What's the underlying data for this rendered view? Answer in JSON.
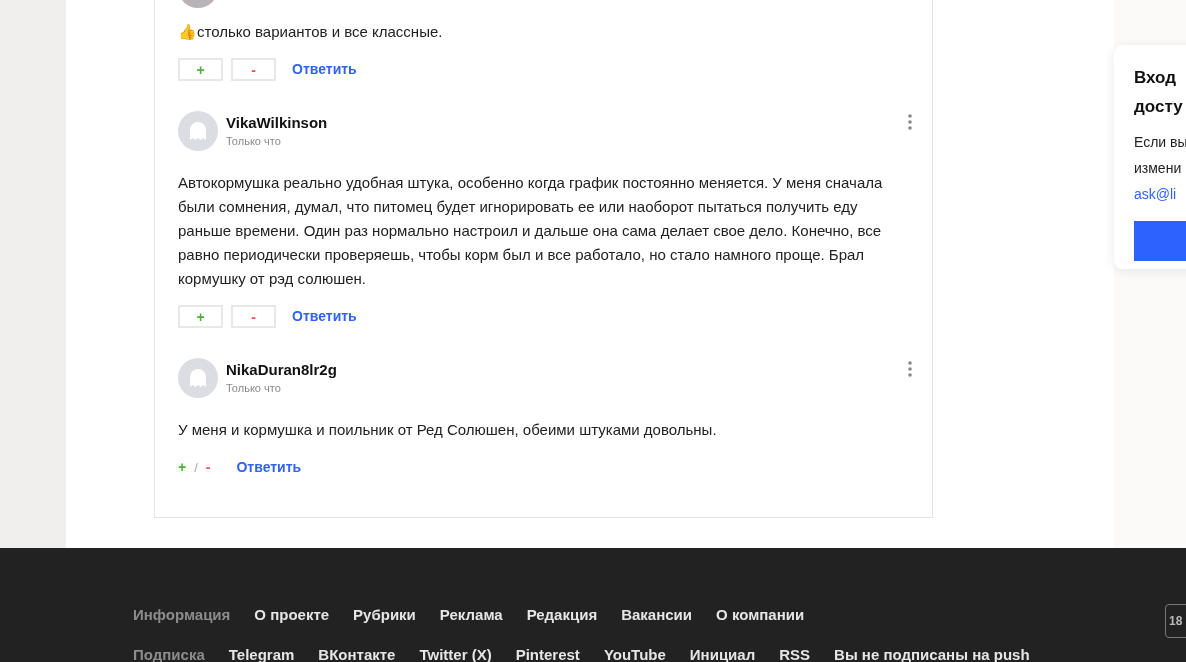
{
  "comments": [
    {
      "text": "👍столько вариантов и все классные.",
      "kind": "boxed",
      "vote_plus": "+",
      "vote_minus": "-",
      "reply": "Ответить"
    },
    {
      "author": "VikaWilkinson",
      "time": "Только что",
      "text": "Автокормушка реально удобная штука, особенно когда график постоянно меняется. У меня сначала были сомнения, думал, что питомец будет игнорировать ее или наоборот пытаться получить еду раньше времени. Один раз нормально настроил и дальше она сама делает свое дело. Конечно, все равно периодически проверяешь, чтобы корм был и все работало, но стало намного проще. Брал кормушку от рэд солюшен.",
      "kind": "boxed",
      "vote_plus": "+",
      "vote_minus": "-",
      "reply": "Ответить"
    },
    {
      "author": "NikaDuran8lr2g",
      "time": "Только что",
      "text": "У меня и кормушка и поильник от Ред Солюшен, обеими штуками довольны.",
      "kind": "inline",
      "vote_plus": "+",
      "vote_separator": "/",
      "vote_minus": "-",
      "reply": "Ответить"
    }
  ],
  "login_card": {
    "title_lines": [
      "Вход",
      "досту"
    ],
    "text_lines": [
      "Если вы",
      "измени"
    ],
    "link": "ask@li"
  },
  "footer": {
    "rows": [
      {
        "label": "Информация",
        "links": [
          "О проекте",
          "Рубрики",
          "Реклама",
          "Редакция",
          "Вакансии",
          "О компании"
        ]
      },
      {
        "label": "Подписка",
        "links": [
          "Telegram",
          "ВКонтакте",
          "Twitter (X)",
          "Pinterest",
          "YouTube",
          "Инициал",
          "RSS",
          "Вы не подписаны на push"
        ]
      }
    ],
    "age_badge": "18"
  }
}
